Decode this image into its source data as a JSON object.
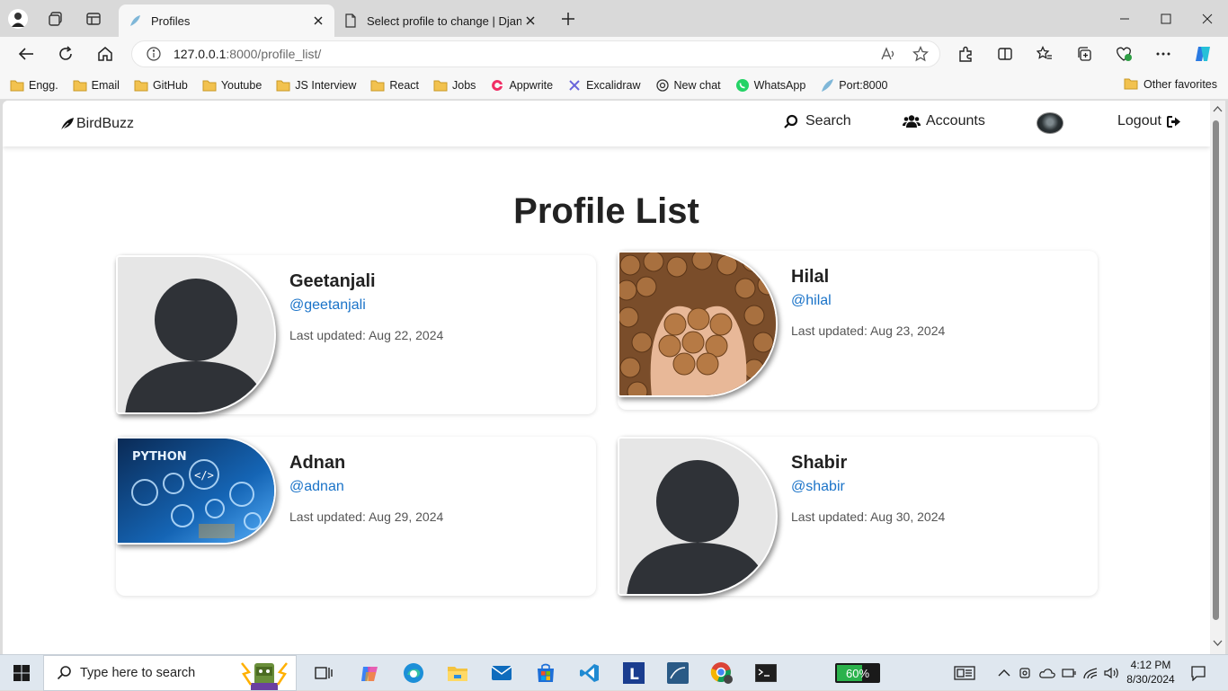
{
  "browser": {
    "tabs": [
      {
        "title": "Profiles",
        "active": true
      },
      {
        "title": "Select profile to change | Django site admin",
        "active": false
      }
    ],
    "url": {
      "host": "127.0.0.1",
      "path": ":8000/profile_list/"
    },
    "bookmarks": [
      {
        "label": "Engg.",
        "icon": "folder-icon"
      },
      {
        "label": "Email",
        "icon": "folder-icon"
      },
      {
        "label": "GitHub",
        "icon": "folder-icon"
      },
      {
        "label": "Youtube",
        "icon": "folder-icon"
      },
      {
        "label": "JS Interview",
        "icon": "folder-icon"
      },
      {
        "label": "React",
        "icon": "folder-icon"
      },
      {
        "label": "Jobs",
        "icon": "folder-icon"
      },
      {
        "label": "Appwrite",
        "icon": "appwrite-icon"
      },
      {
        "label": "Excalidraw",
        "icon": "excalidraw-icon"
      },
      {
        "label": "New chat",
        "icon": "chatgpt-icon"
      },
      {
        "label": "WhatsApp",
        "icon": "whatsapp-icon"
      },
      {
        "label": "Port:8000",
        "icon": "django-icon"
      }
    ],
    "other_favorites": "Other favorites"
  },
  "site": {
    "brand": "BirdBuzz",
    "nav": {
      "search": "Search",
      "accounts": "Accounts",
      "logout": "Logout"
    },
    "page_title": "Profile List",
    "profiles": [
      {
        "name": "Geetanjali",
        "handle": "@geetanjali",
        "updated": "Last updated: Aug 22, 2024",
        "image": "default-avatar"
      },
      {
        "name": "Hilal",
        "handle": "@hilal",
        "updated": "Last updated: Aug 23, 2024",
        "image": "walnuts-photo"
      },
      {
        "name": "Adnan",
        "handle": "@adnan",
        "updated": "Last updated: Aug 29, 2024",
        "image": "python-banner",
        "image_text": "PYTHON"
      },
      {
        "name": "Shabir",
        "handle": "@shabir",
        "updated": "Last updated: Aug 30, 2024",
        "image": "default-avatar"
      }
    ]
  },
  "taskbar": {
    "search_placeholder": "Type here to search",
    "battery": "60%",
    "time": "4:12 PM",
    "date": "8/30/2024"
  },
  "colors": {
    "link": "#1a73c8",
    "avatar_dark": "#2f3237",
    "avatar_bg": "#e6e6e6"
  }
}
